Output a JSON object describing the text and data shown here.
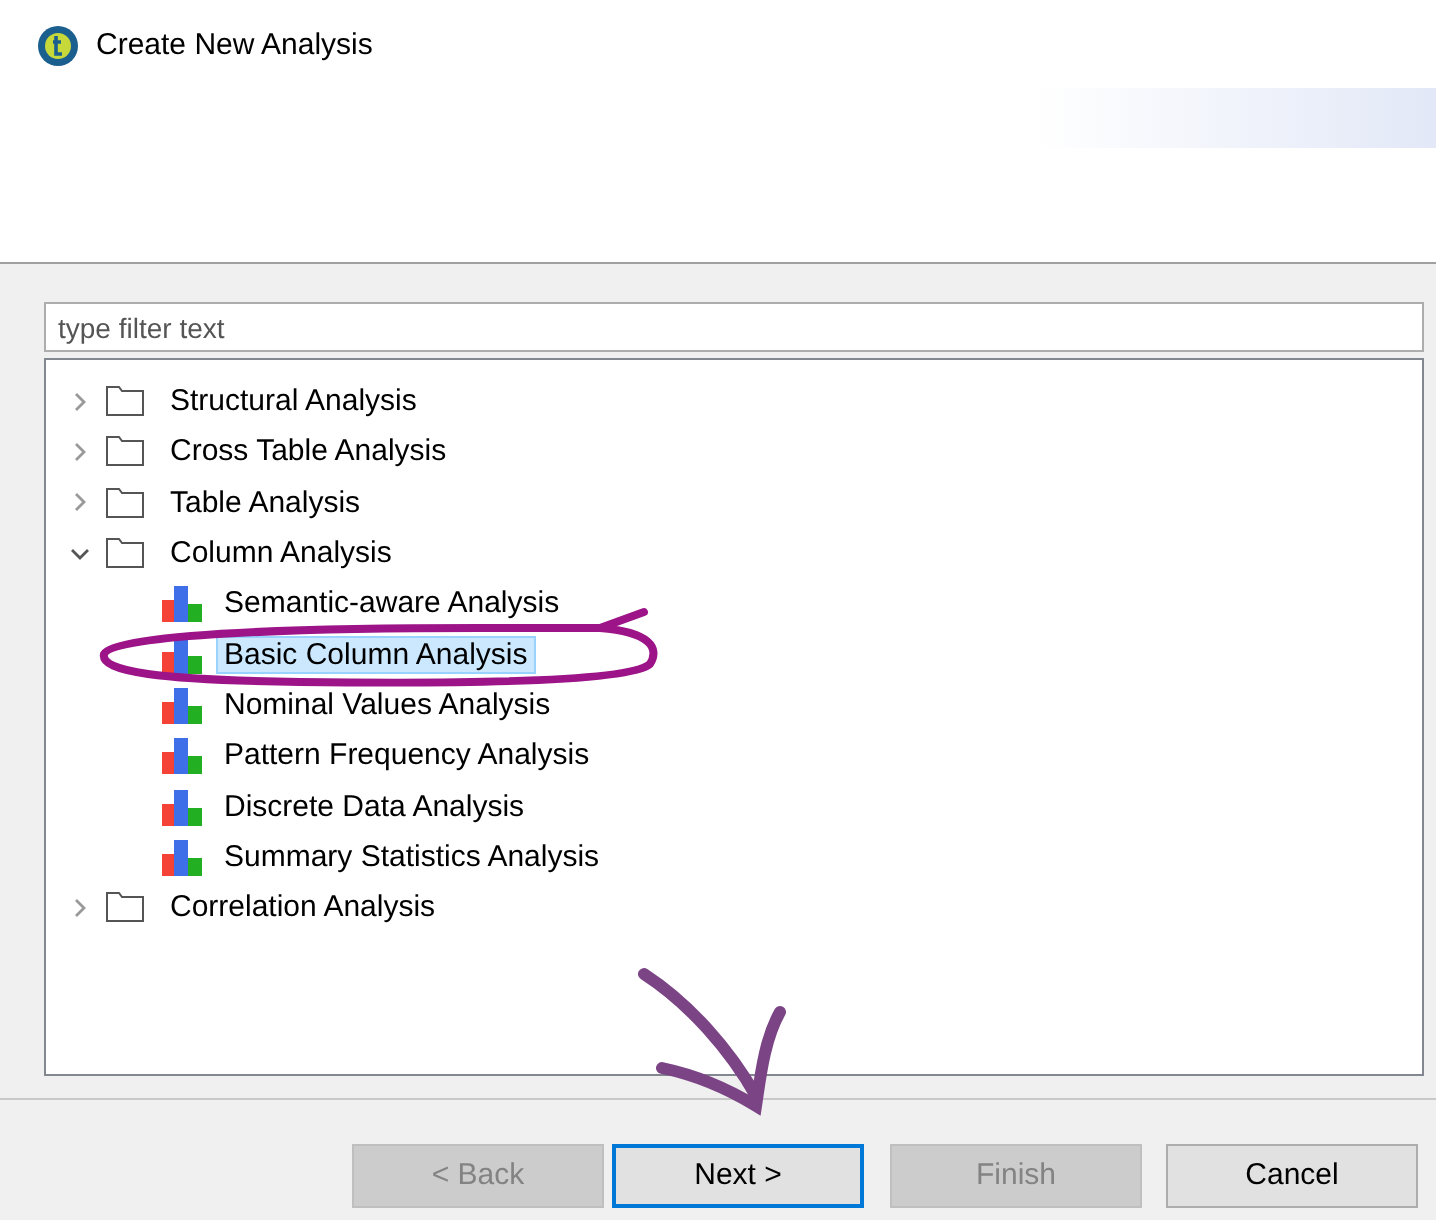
{
  "window": {
    "title": "Create New Analysis"
  },
  "filter": {
    "placeholder": "type filter text"
  },
  "tree": [
    {
      "label": "Structural Analysis",
      "kind": "folder",
      "expanded": false,
      "selected": false
    },
    {
      "label": "Cross Table Analysis",
      "kind": "folder",
      "expanded": false,
      "selected": false
    },
    {
      "label": "Table Analysis",
      "kind": "folder",
      "expanded": false,
      "selected": false
    },
    {
      "label": "Column Analysis",
      "kind": "folder",
      "expanded": true,
      "selected": false,
      "children": [
        {
          "label": "Semantic-aware Analysis",
          "kind": "analysis",
          "selected": false
        },
        {
          "label": "Basic Column Analysis",
          "kind": "analysis",
          "selected": true
        },
        {
          "label": "Nominal Values Analysis",
          "kind": "analysis",
          "selected": false
        },
        {
          "label": "Pattern Frequency Analysis",
          "kind": "analysis",
          "selected": false
        },
        {
          "label": "Discrete Data Analysis",
          "kind": "analysis",
          "selected": false
        },
        {
          "label": "Summary Statistics Analysis",
          "kind": "analysis",
          "selected": false
        }
      ]
    },
    {
      "label": "Correlation Analysis",
      "kind": "folder",
      "expanded": false,
      "selected": false
    }
  ],
  "buttons": [
    {
      "label": "< Back",
      "disabled": true,
      "default": false
    },
    {
      "label": "Next >",
      "disabled": false,
      "default": true
    },
    {
      "label": "Finish",
      "disabled": true,
      "default": false
    },
    {
      "label": "Cancel",
      "disabled": false,
      "default": false
    }
  ],
  "annotations": [
    {
      "kind": "ellipse",
      "color": "#9c1488"
    },
    {
      "kind": "arrow",
      "color": "#7b4585"
    }
  ]
}
